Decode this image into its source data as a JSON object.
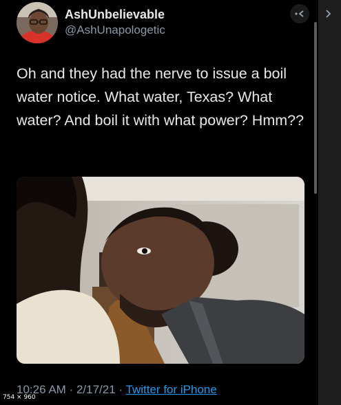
{
  "tweet": {
    "display_name": "AshUnbelievable",
    "handle": "@AshUnapologetic",
    "text": "Oh and they had the nerve to issue a boil water notice. What water, Texas? What water? And boil it with what power? Hmm??",
    "time": "10:26 AM",
    "date": "2/17/21",
    "separator": "·",
    "source": "Twitter for iPhone"
  },
  "overlay": {
    "dimensions": "754 × 960"
  },
  "icons": {
    "more": "more-icon",
    "next": "chevron-right-icon"
  },
  "colors": {
    "background": "#000000",
    "text": "#e7e9ea",
    "muted": "#8b98a5",
    "link": "#1d9bf0"
  }
}
